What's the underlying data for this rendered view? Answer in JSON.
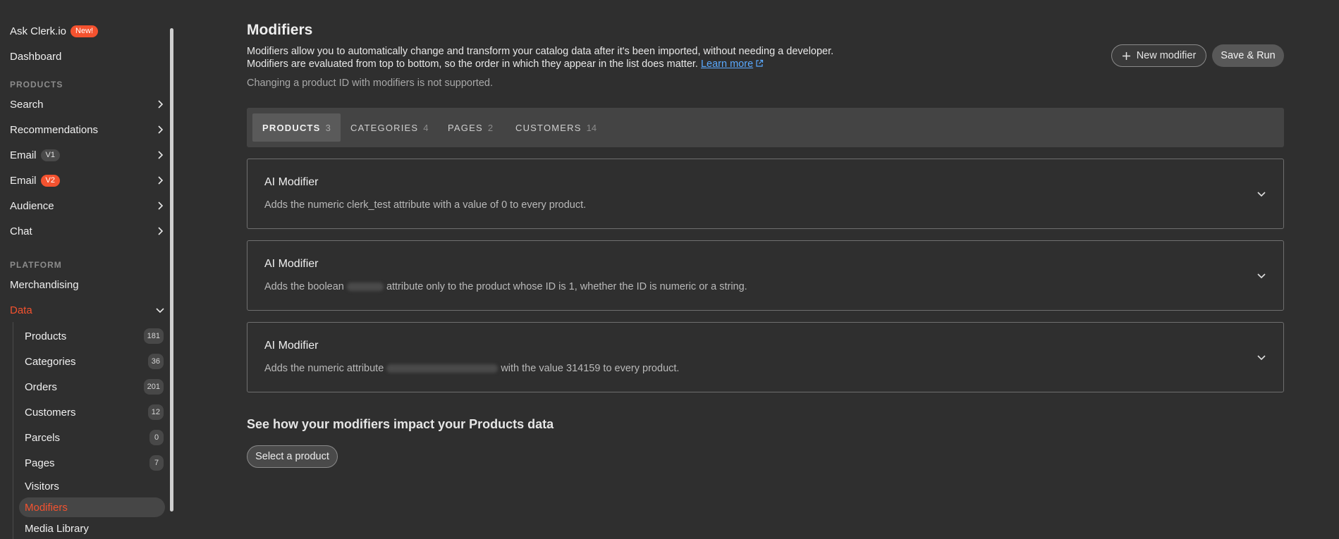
{
  "sidebar": {
    "ask": {
      "label": "Ask Clerk.io",
      "badge": "New!"
    },
    "dashboard": "Dashboard",
    "products_section": "PRODUCTS",
    "search": "Search",
    "recommendations": "Recommendations",
    "email_v1": {
      "label": "Email",
      "badge": "V1"
    },
    "email_v2": {
      "label": "Email",
      "badge": "V2"
    },
    "audience": "Audience",
    "chat": "Chat",
    "platform_section": "PLATFORM",
    "merchandising": "Merchandising",
    "data": "Data",
    "data_items": [
      {
        "label": "Products",
        "count": "181"
      },
      {
        "label": "Categories",
        "count": "36"
      },
      {
        "label": "Orders",
        "count": "201"
      },
      {
        "label": "Customers",
        "count": "12"
      },
      {
        "label": "Parcels",
        "count": "0"
      },
      {
        "label": "Pages",
        "count": "7"
      },
      {
        "label": "Visitors"
      },
      {
        "label": "Modifiers"
      },
      {
        "label": "Media Library"
      }
    ]
  },
  "main": {
    "title": "Modifiers",
    "description_line1": "Modifiers allow you to automatically change and transform your catalog data after it's been imported, without needing a developer.",
    "description_line2": "Modifiers are evaluated from top to bottom, so the order in which they appear in the list does matter.",
    "learn_more": "Learn more",
    "note": "Changing a product ID with modifiers is not supported.",
    "new_modifier_button": "New modifier",
    "save_run_button": "Save & Run",
    "tabs": [
      {
        "label": "PRODUCTS",
        "count": "3"
      },
      {
        "label": "CATEGORIES",
        "count": "4"
      },
      {
        "label": "PAGES",
        "count": "2"
      },
      {
        "label": "CUSTOMERS",
        "count": "14"
      }
    ],
    "modifiers": [
      {
        "title": "AI Modifier",
        "desc": "Adds the numeric clerk_test attribute with a value of 0 to every product."
      },
      {
        "title": "AI Modifier",
        "desc_before": "Adds the boolean",
        "desc_after": "attribute only to the product whose ID is 1, whether the ID is numeric or a string."
      },
      {
        "title": "AI Modifier",
        "desc_before": "Adds the numeric attribute",
        "desc_after": "with the value 314159 to every product."
      }
    ],
    "impact_title": "See how your modifiers impact your Products data",
    "select_product_button": "Select a product"
  },
  "colors": {
    "background": "#2f2f2f",
    "accent": "#f4522f",
    "link": "#5aa9ff"
  }
}
